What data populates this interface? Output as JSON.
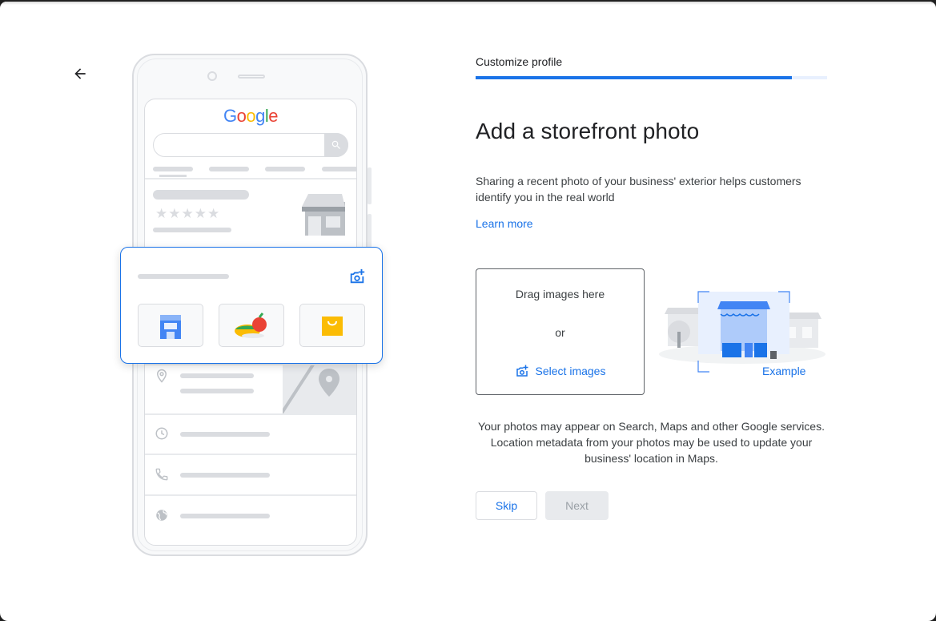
{
  "header": {
    "step_label": "Customize profile",
    "progress": 0.9
  },
  "content": {
    "title": "Add a storefront photo",
    "description": "Sharing a recent photo of your business' exterior helps customers identify you in the real world",
    "learn_more": "Learn more"
  },
  "upload": {
    "drag_text": "Drag images here",
    "or_text": "or",
    "select_label": "Select images",
    "example_label": "Example"
  },
  "note": "Your photos may appear on Search, Maps and other Google services. Location metadata from your photos may be used to update your business' location in Maps.",
  "actions": {
    "skip_label": "Skip",
    "next_label": "Next"
  },
  "illustration": {
    "logo_letters": [
      "G",
      "o",
      "o",
      "g",
      "l",
      "e"
    ],
    "logo_colors": [
      "#4285F4",
      "#EA4335",
      "#FBBC05",
      "#4285F4",
      "#34A853",
      "#EA4335"
    ],
    "icons": [
      "back-arrow-icon",
      "search-icon",
      "add-photo-icon",
      "location-pin-icon",
      "clock-icon",
      "phone-icon",
      "globe-icon",
      "storefront-icon"
    ]
  },
  "colors": {
    "accent": "#1a73e8",
    "progress_track": "#e8f0fe",
    "disabled_bg": "#e8eaed"
  }
}
